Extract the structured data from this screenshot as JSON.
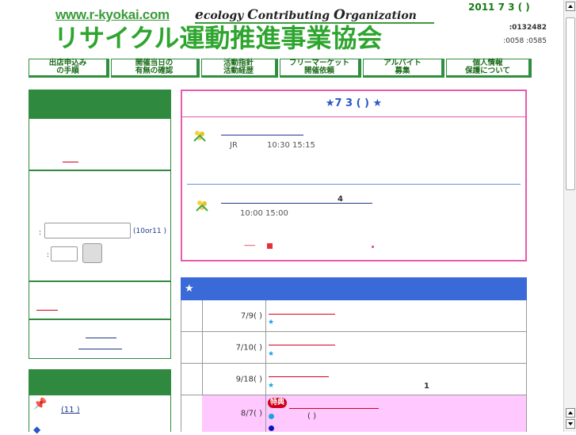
{
  "header": {
    "site_url": "www.r-kyokai.com",
    "eco_e": "e",
    "eco_rest1": "cology ",
    "eco_c": "C",
    "eco_rest2": "ontributing ",
    "eco_o": "O",
    "eco_rest3": "rganization",
    "title": "リサイクル運動推進事業協会",
    "date": "2011  7  3  (  )",
    "counter_total": ":0132482",
    "counter_today": ":0058  :0585"
  },
  "nav": [
    {
      "label": "出店申込み\nの手順"
    },
    {
      "label": "開催当日の\n有無の確認"
    },
    {
      "label": "活動指針\n活動経歴"
    },
    {
      "label": "フリーマーケット\n開催依頼"
    },
    {
      "label": "アルバイト\n募集"
    },
    {
      "label": "個人情報\n保護について"
    }
  ],
  "sidebar": {
    "search_hint": "(10or11 )",
    "search_label": ":",
    "search_label2": ":",
    "list_item1": "(11 )"
  },
  "news": {
    "title": "★7  3  (  )                    ★",
    "item1_meta_a": "JR",
    "item1_meta_b": "10:30 15:15",
    "item2_number": "4",
    "item2_time": "10:00  15:00",
    "more_dashes": "-------"
  },
  "events": {
    "header": "★",
    "rows": [
      {
        "date": "7/9(  )"
      },
      {
        "date": "7/10(  )"
      },
      {
        "date": "9/18(  )",
        "extra": "1"
      },
      {
        "date": "8/7(  )",
        "badge": "特典",
        "paren": "(     )"
      }
    ]
  },
  "colors": {
    "green": "#2ea52e",
    "nav_border": "#2f8f3f",
    "pink": "#e85aad",
    "blue_header": "#3a6ad8",
    "row_pink_bg": "#ffc8ff"
  }
}
